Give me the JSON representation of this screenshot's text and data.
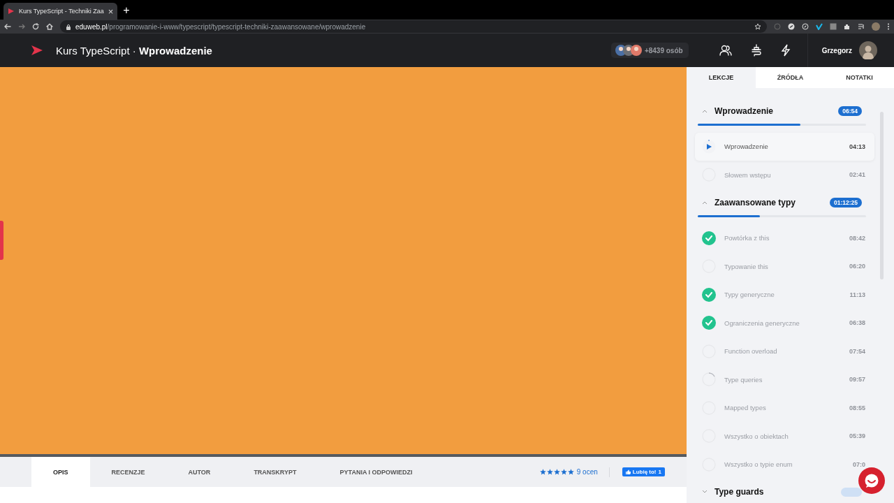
{
  "browser": {
    "tab_title": "Kurs TypeScript - Techniki Zaa",
    "tab_close": "×",
    "new_tab": "+",
    "url_domain": "eduweb.pl",
    "url_path": "/programowanie-i-www/typescript/typescript-techniki-zaawansowane/wprowadzenie"
  },
  "header": {
    "title": "Kurs TypeScript · **Wprowadzenie**",
    "viewers": "+8439 osób",
    "user_name": "Grzegorz"
  },
  "sidebar": {
    "tabs": [
      {
        "label": "LEKCJE",
        "selected": true
      },
      {
        "label": "ŹRÓDŁA",
        "selected": false
      },
      {
        "label": "NOTATKI",
        "selected": false
      }
    ],
    "sections": [
      {
        "title": "Wprowadzenie",
        "duration": "06:54",
        "expanded": true,
        "level": 0.61,
        "lessons": [
          {
            "title": "Wprowadzenie",
            "duration": "04:13",
            "kind": "playing"
          },
          {
            "title": "Słowem wstępu",
            "duration": "02:41",
            "kind": "none"
          }
        ]
      },
      {
        "title": "Zaawansowane typy",
        "duration": "01:12:25",
        "expanded": true,
        "level": 0.37,
        "lessons": [
          {
            "title": "Powtórka z this",
            "duration": "08:42",
            "kind": "done"
          },
          {
            "title": "Typowanie this",
            "duration": "06:20",
            "kind": "none"
          },
          {
            "title": "Typy generyczne",
            "duration": "11:13",
            "kind": "done"
          },
          {
            "title": "Ograniczenia generyczne",
            "duration": "06:38",
            "kind": "done"
          },
          {
            "title": "Function overload",
            "duration": "07:54",
            "kind": "none"
          },
          {
            "title": "Type queries",
            "duration": "09:57",
            "kind": "partial"
          },
          {
            "title": "Mapped types",
            "duration": "08:55",
            "kind": "none"
          },
          {
            "title": "Wszystko o obiektach",
            "duration": "05:39",
            "kind": "none"
          },
          {
            "title": "Wszystko o typie enum",
            "duration": "07:0",
            "kind": "none"
          }
        ]
      },
      {
        "title": "Type guards",
        "expanded": false
      }
    ]
  },
  "bottom_tabs": [
    {
      "label": "OPIS",
      "selected": true
    },
    {
      "label": "RECENZJE",
      "selected": false
    },
    {
      "label": "AUTOR",
      "selected": false
    },
    {
      "label": "TRANSKRYPT",
      "selected": false
    },
    {
      "label": "PYTANIA I ODPOWIEDZI",
      "selected": false
    }
  ],
  "rating": {
    "stars": 5,
    "count": "9 ocen"
  },
  "like_button": {
    "label": "Lubię to!",
    "count": "1"
  }
}
